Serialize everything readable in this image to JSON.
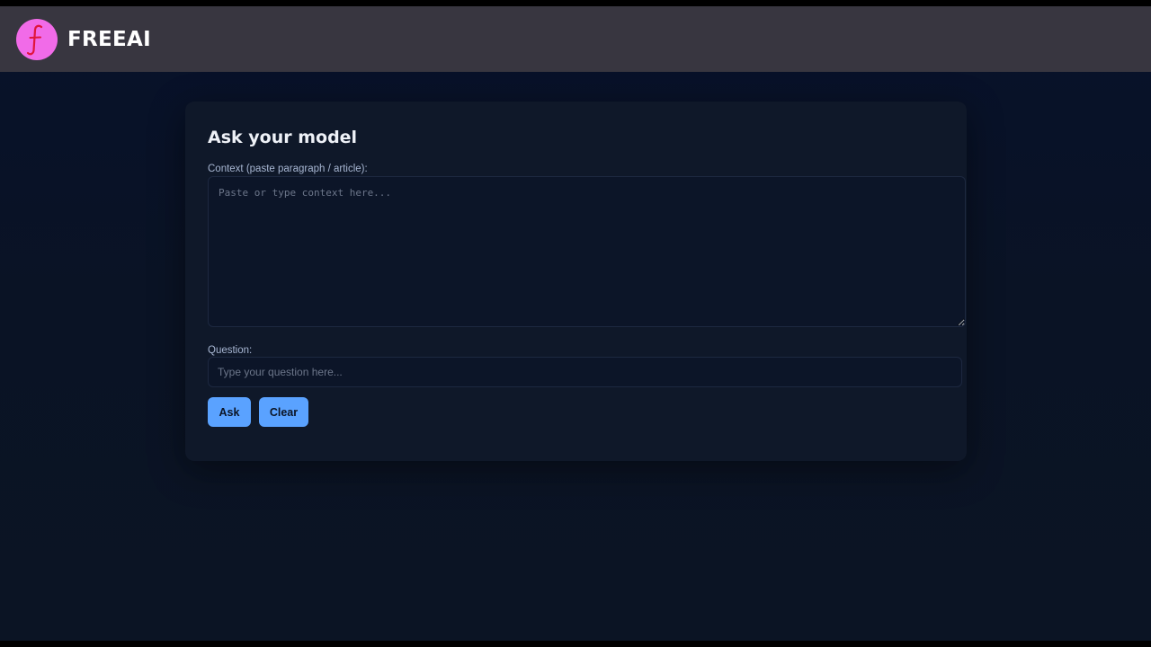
{
  "header": {
    "logo_letter": "f",
    "brand": "FREEAI"
  },
  "colors": {
    "topbar": "#383640",
    "logo_bg": "#f16be8",
    "logo_glyph": "#e0153c",
    "page_bg": "#0a1325",
    "card_bg": "#0f1829",
    "accent": "#5aa2ff"
  },
  "card": {
    "title": "Ask your model",
    "context_label": "Context (paste paragraph / article):",
    "context_value": "",
    "context_placeholder": "Paste or type context here...",
    "question_label": "Question:",
    "question_value": "",
    "question_placeholder": "Type your question here...",
    "ask_label": "Ask",
    "clear_label": "Clear"
  }
}
